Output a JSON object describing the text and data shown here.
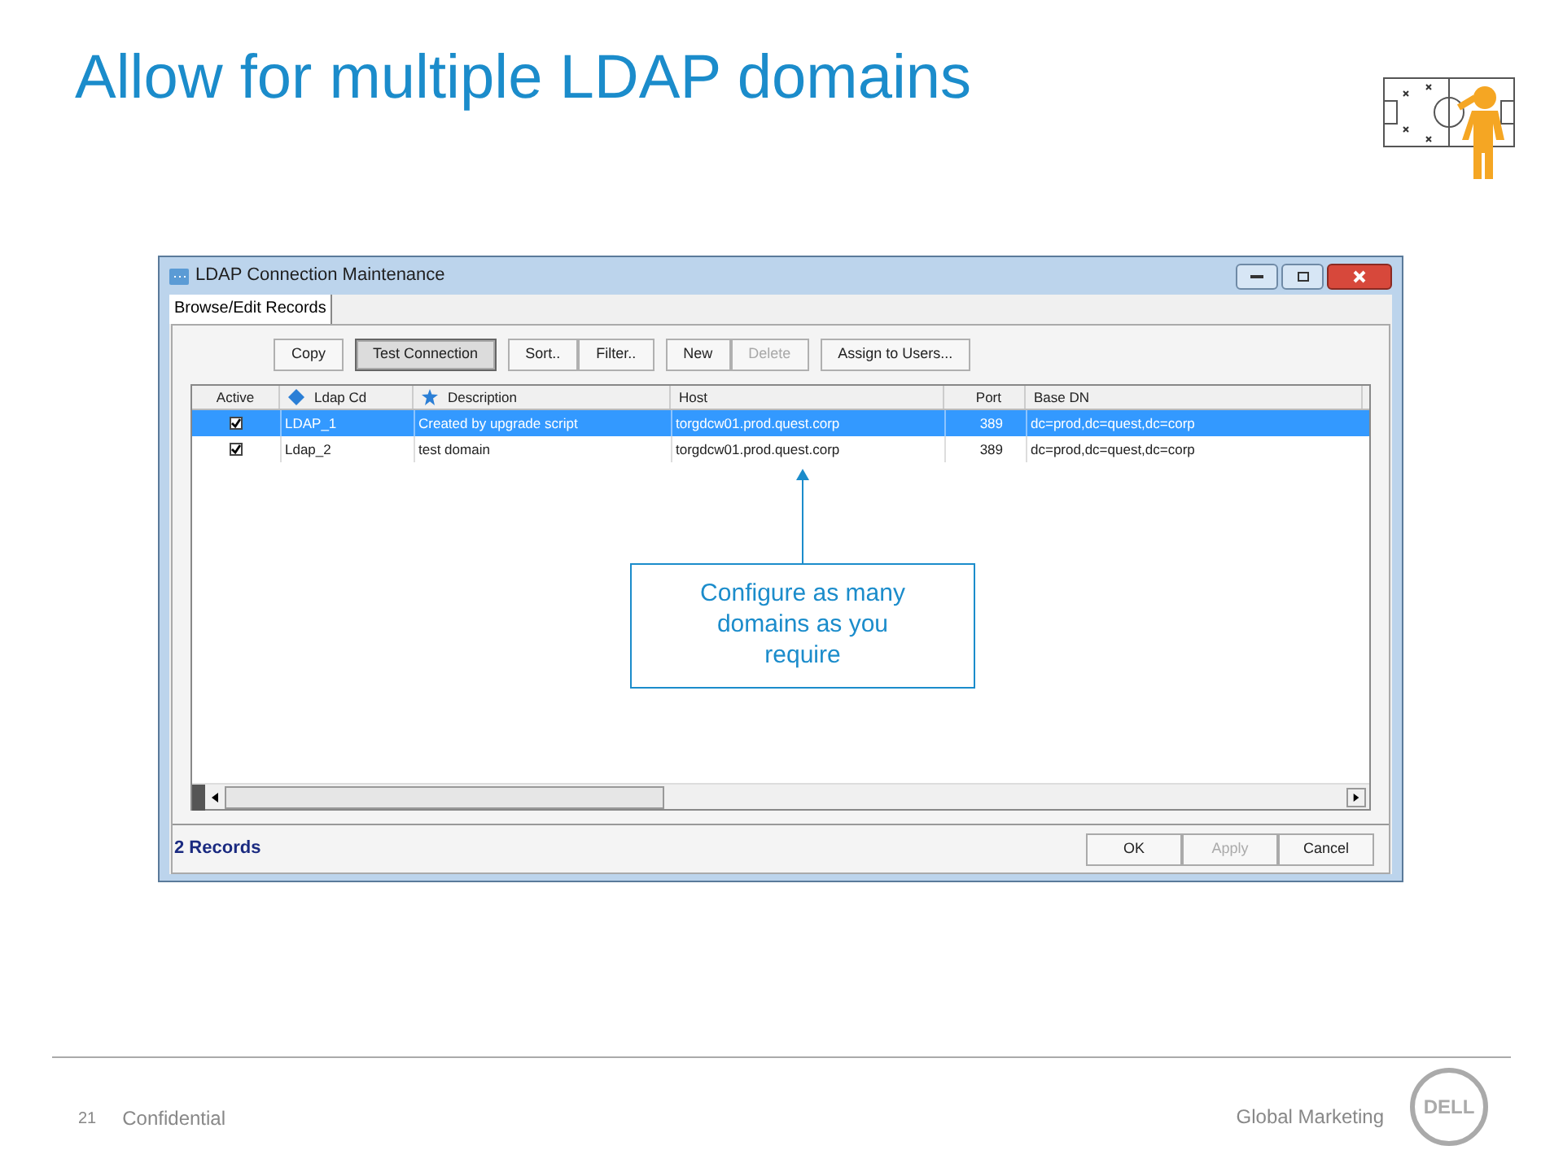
{
  "slide": {
    "title": "Allow for multiple LDAP domains"
  },
  "window": {
    "title": "LDAP Connection Maintenance",
    "tabs": [
      {
        "label": "Browse/Edit Records",
        "selected": true
      }
    ],
    "toolbar": [
      [
        {
          "label": "Copy",
          "disabled": false,
          "focused": false
        }
      ],
      [
        {
          "label": "Test Connection",
          "disabled": false,
          "focused": true
        }
      ],
      [
        {
          "label": "Sort..",
          "disabled": false,
          "focused": false
        },
        {
          "label": "Filter..",
          "disabled": false,
          "focused": false
        }
      ],
      [
        {
          "label": "New",
          "disabled": false,
          "focused": false
        },
        {
          "label": "Delete",
          "disabled": true,
          "focused": false
        }
      ],
      [
        {
          "label": "Assign to Users...",
          "disabled": false,
          "focused": false
        }
      ]
    ],
    "table": {
      "active_header": "Active",
      "columns": [
        "Ldap Cd",
        "Description",
        "Host",
        "Port",
        "Base DN"
      ],
      "rows": [
        {
          "selected": true,
          "active": true,
          "cells": [
            "LDAP_1",
            "Created by upgrade script",
            "torgdcw01.prod.quest.corp",
            "389",
            "dc=prod,dc=quest,dc=corp"
          ]
        },
        {
          "selected": false,
          "active": true,
          "cells": [
            "Ldap_2",
            "test domain",
            "torgdcw01.prod.quest.corp",
            "389",
            "dc=prod,dc=quest,dc=corp"
          ]
        }
      ]
    },
    "status": "2 Records",
    "buttons": [
      {
        "label": "OK",
        "disabled": false
      },
      {
        "label": "Apply",
        "disabled": true
      },
      {
        "label": "Cancel",
        "disabled": false
      }
    ]
  },
  "callout": "Configure as many domains as you require",
  "footer": {
    "page": "21",
    "label": "Confidential",
    "department": "Global Marketing",
    "logo": "DELL"
  }
}
